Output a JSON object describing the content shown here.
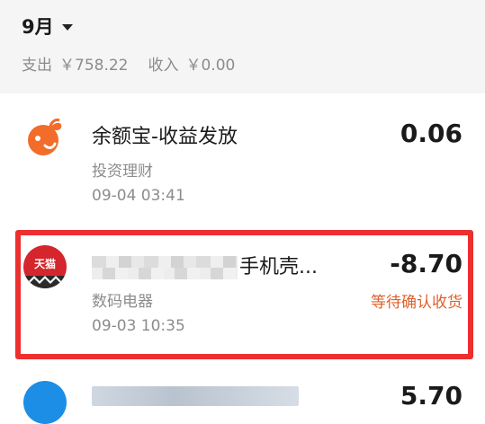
{
  "header": {
    "month": "9月",
    "expense_label": "支出",
    "expense_value": "￥758.22",
    "income_label": "收入",
    "income_value": "￥0.00"
  },
  "items": [
    {
      "title": "余额宝-收益发放",
      "category": "投资理财",
      "time": "09-04  03:41",
      "amount": "0.06",
      "icon": "yuebao-icon"
    },
    {
      "title_visible": "手机壳...",
      "category": "数码电器",
      "time": "09-03  10:35",
      "amount": "-8.70",
      "status": "等待确认收货",
      "icon": "tmall-icon",
      "icon_text": "天猫"
    },
    {
      "amount": "5.70",
      "icon": "transfer-icon"
    }
  ],
  "colors": {
    "header_bg": "#f5f5f5",
    "status": "#e0602b",
    "highlight": "#ee2f2f",
    "yuebao_orange": "#f26c2a",
    "tmall_red": "#d4262c"
  }
}
